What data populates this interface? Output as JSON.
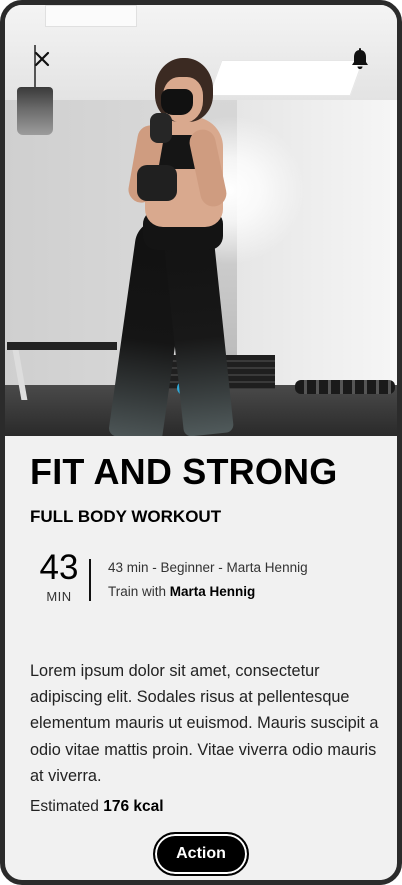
{
  "header": {
    "close_icon": "close-icon",
    "bell_icon": "bell-icon"
  },
  "hero": {
    "image": "woman-with-dumbbells-photo"
  },
  "workout": {
    "title": "FIT AND STRONG",
    "subtitle": "FULL BODY WORKOUT",
    "duration_value": "43",
    "duration_unit": "MIN",
    "meta_summary": "43 min - Beginner - Marta Hennig",
    "trainer_prefix": "Train with ",
    "trainer_name": "Marta Hennig",
    "description": "Lorem ipsum dolor sit amet, consectetur adipiscing elit. Sodales risus at pellentesque elementum mauris ut euismod. Mauris suscipit a odio vitae mattis proin. Vitae viverra odio mauris at viverra.",
    "calories_prefix": "Estimated ",
    "calories_value": "176 kcal"
  },
  "actions": {
    "primary_label": "Action"
  },
  "colors": {
    "background": "#f1f1f1",
    "frame": "#2b2b2b",
    "text": "#000000",
    "button": "#000000"
  }
}
